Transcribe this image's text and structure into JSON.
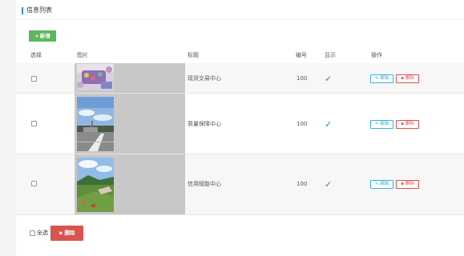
{
  "panel": {
    "title": "信息列表"
  },
  "toolbar": {
    "add_icon": "plus-icon",
    "add_label": "新增"
  },
  "table": {
    "headers": {
      "select": "选择",
      "image": "图片",
      "title": "标题",
      "number": "编号",
      "display": "显示",
      "actions": "操作"
    },
    "rows": [
      {
        "title": "现货交易中心",
        "number": "100",
        "display_icon": "check-icon",
        "display_glyph": "✓",
        "edit_label": "编辑",
        "delete_label": "删除"
      },
      {
        "title": "质量保障中心",
        "number": "100",
        "display_icon": "check-icon",
        "display_glyph": "✓",
        "edit_label": "编辑",
        "delete_label": "删除"
      },
      {
        "title": "信用赋能中心",
        "number": "100",
        "display_icon": "check-icon",
        "display_glyph": "✓",
        "edit_label": "编辑",
        "delete_label": "删除"
      }
    ]
  },
  "footer": {
    "select_all_label": "全选",
    "batch_delete_label": "删除"
  },
  "colors": {
    "accent": "#2a8ef0",
    "add_button": "#5cb85c",
    "delete": "#d9534f",
    "edit": "#39b3d7",
    "check": "#2e9e2e"
  }
}
